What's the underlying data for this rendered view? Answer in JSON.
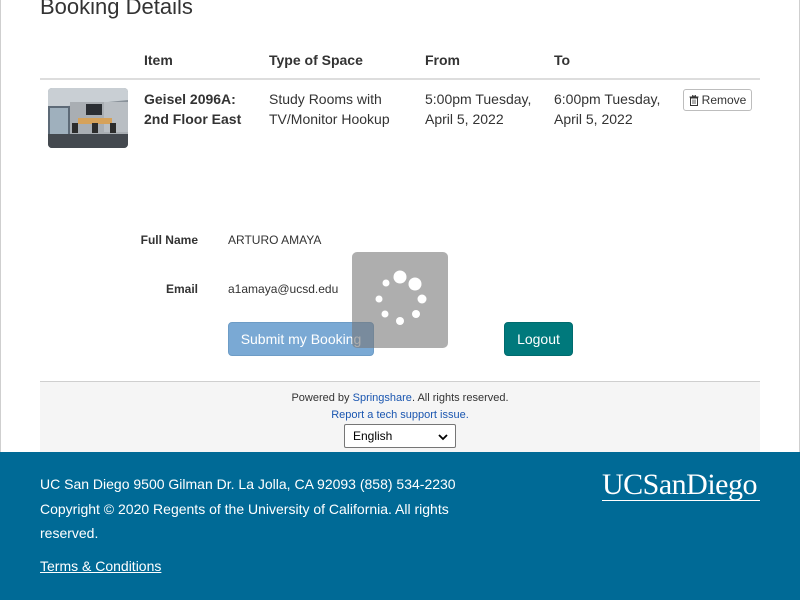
{
  "page": {
    "heading": "Booking Details"
  },
  "table": {
    "headers": [
      "Item",
      "Type of Space",
      "From",
      "To"
    ],
    "rows": [
      {
        "item": "Geisel 2096A: 2nd Floor East",
        "type_of_space": "Study Rooms with TV/Monitor Hookup",
        "from": "5:00pm Tuesday, April 5, 2022",
        "to": "6:00pm Tuesday, April 5, 2022",
        "remove_label": "Remove",
        "thumbnail_icon": "room-photo"
      }
    ]
  },
  "form": {
    "full_name_label": "Full Name",
    "full_name_value": "ARTURO AMAYA",
    "email_label": "Email",
    "email_value": "a1amaya@ucsd.edu",
    "submit_label": "Submit my Booking",
    "logout_label": "Logout",
    "spinner_icon": "loading-spinner"
  },
  "powered": {
    "prefix": "Powered by ",
    "brand": "Springshare",
    "suffix": ". All rights reserved.",
    "support_link": "Report a tech support issue.",
    "language_selected": "English"
  },
  "footer": {
    "address": "UC San Diego 9500 Gilman Dr. La Jolla, CA 92093 (858) 534-2230",
    "copyright": "Copyright © 2020 Regents of the University of California. All rights reserved.",
    "terms_label": "Terms & Conditions",
    "logo_text": "UCSanDiego"
  },
  "colors": {
    "footer_bg": "#006a96",
    "submit_bg": "#7aa9d4",
    "logout_bg": "#00797c",
    "link": "#1a56b0"
  }
}
